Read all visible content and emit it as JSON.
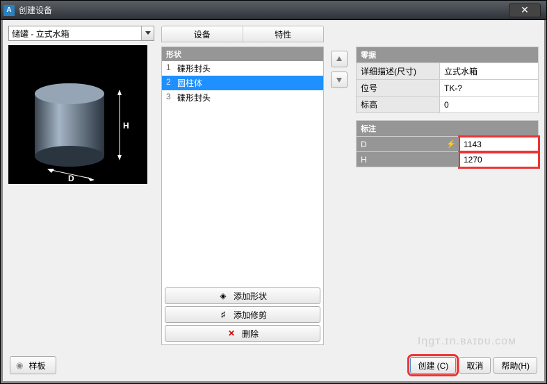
{
  "window": {
    "title": "创建设备"
  },
  "left": {
    "combo_value": "储罐 - 立式水箱"
  },
  "tabs": {
    "equipment": "设备",
    "properties": "特性"
  },
  "shapes": {
    "header": "形状",
    "items": [
      {
        "n": "1",
        "label": "碟形封头"
      },
      {
        "n": "2",
        "label": "圆柱体"
      },
      {
        "n": "3",
        "label": "碟形封头"
      }
    ],
    "btn_add_shape": "添加形状",
    "btn_add_trim": "添加修剪",
    "btn_delete": "删除"
  },
  "data_panel": {
    "header": "零据",
    "rows": {
      "desc_label": "详细描述(尺寸)",
      "desc_value": "立式水箱",
      "tag_label": "位号",
      "tag_value": "TK-?",
      "elev_label": "标高",
      "elev_value": "0"
    }
  },
  "dims": {
    "header": "标注",
    "d_label": "D",
    "d_value": "1143",
    "h_label": "H",
    "h_value": "1270"
  },
  "buttons": {
    "template": "样板",
    "create": "创建 (C)",
    "cancel": "取消",
    "help": "帮助(H)"
  },
  "preview": {
    "d_label": "D",
    "h_label": "H"
  }
}
